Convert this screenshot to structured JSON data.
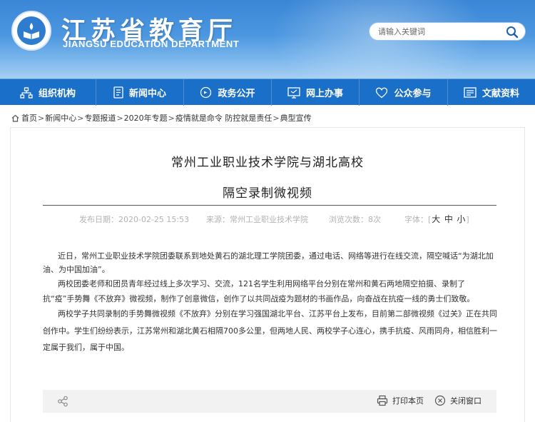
{
  "header": {
    "site_title": "江苏省教育厅",
    "site_subtitle": "JIANGSU EDUCATION DEPARTMENT",
    "search_placeholder": "请输入关键词"
  },
  "nav": {
    "items": [
      {
        "label": "组织机构",
        "icon": "org-chart-icon"
      },
      {
        "label": "新闻中心",
        "icon": "document-icon"
      },
      {
        "label": "政务公开",
        "icon": "chat-icon"
      },
      {
        "label": "网上办事",
        "icon": "monitor-icon"
      },
      {
        "label": "公众参与",
        "icon": "heart-icon"
      },
      {
        "label": "文献资料",
        "icon": "folder-icon"
      }
    ]
  },
  "breadcrumb": {
    "items": [
      "首页",
      "新闻中心",
      "专题报道",
      "2020年专题",
      "疫情就是命令 防控就是责任",
      "典型宣传"
    ]
  },
  "article": {
    "title_line1": "常州工业职业技术学院与湖北高校",
    "title_line2": "隔空录制微视频",
    "publish_date": "发布日期：2020-02-25 15:53",
    "source": "来源：常州工业职业技术学院",
    "views": "浏览次数：8次",
    "font_label": "字体：",
    "font_open": "[",
    "font_large": "大",
    "font_medium": "中",
    "font_small": "小",
    "font_close": "]",
    "lines": [
      "近日，常州工业职业技术学院团委联系到地处黄石的湖北理工学院团委，通过电话、网络等进行在线交流，隔空喊话“为湖北加",
      "油、为中国加油”。",
      "两校团委老师和团员青年经过线上多次学习、交流，121名学生利用网络平台分别在常州和黄石两地隔空拍摄、录制了",
      "抗“疫”手势舞《不放弃》微视频，制作了创意微信，创作了以共同战疫为题材的书画作品，向奋战在抗疫一线的勇士们致敬。",
      "两校学子共同录制的手势舞微视频《不放弃》分别在学习强国湖北平台、江苏平台上发布，目前第二部微视频《过关》正在共同",
      "创作中。学生们纷纷表示，江苏常州和湖北黄石相隔700多公里，但两地人民、两校学子心连心，携手抗疫、风雨同舟，相信胜利一",
      "定属于我们，属于中国。"
    ]
  },
  "toolbar": {
    "print_label": "打印本页",
    "close_label": "关闭窗口"
  },
  "colors": {
    "nav_bg": "#1a6fc8",
    "header_top": "#3a86d6",
    "header_bottom": "#a7cff3",
    "toolbar_bg": "#f2f2f2"
  }
}
